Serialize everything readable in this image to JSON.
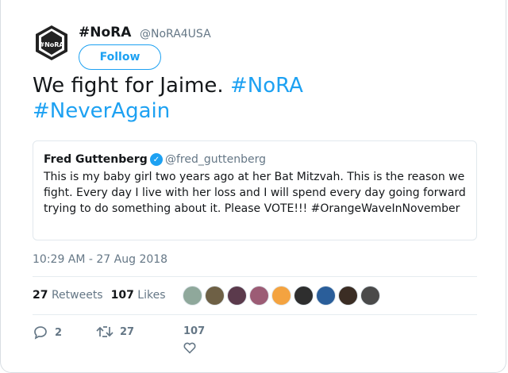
{
  "user": {
    "name": "#NoRA",
    "handle": "@NoRA4USA",
    "avatar_label": "#NoRA",
    "follow_label": "Follow"
  },
  "tweet": {
    "text_main": "We fight for Jaime.",
    "hashtags": [
      "#NoRA",
      "#NeverAgain"
    ],
    "timestamp": "10:29 AM - 27 Aug 2018"
  },
  "quoted": {
    "name": "Fred Guttenberg",
    "handle": "@fred_guttenberg",
    "verified": true,
    "text": "This is my baby girl two years ago at her Bat Mitzvah.  This is the reason we fight.  Every day I live with her loss and I will spend every day going forward trying to do something about it.  Please VOTE!!! #OrangeWaveInNovember"
  },
  "stats": {
    "retweets": "27",
    "retweets_label": "Retweets",
    "likes": "107",
    "likes_label": "Likes"
  },
  "actions": {
    "reply_count": "2",
    "retweet_count": "27",
    "like_count": "107"
  },
  "likers": [
    "#8fa89b",
    "#6e6045",
    "#5b3a4c",
    "#9c5c75",
    "#f4a340",
    "#2e2e2e",
    "#2a5e9a",
    "#3b2d24",
    "#4a4a4a"
  ]
}
